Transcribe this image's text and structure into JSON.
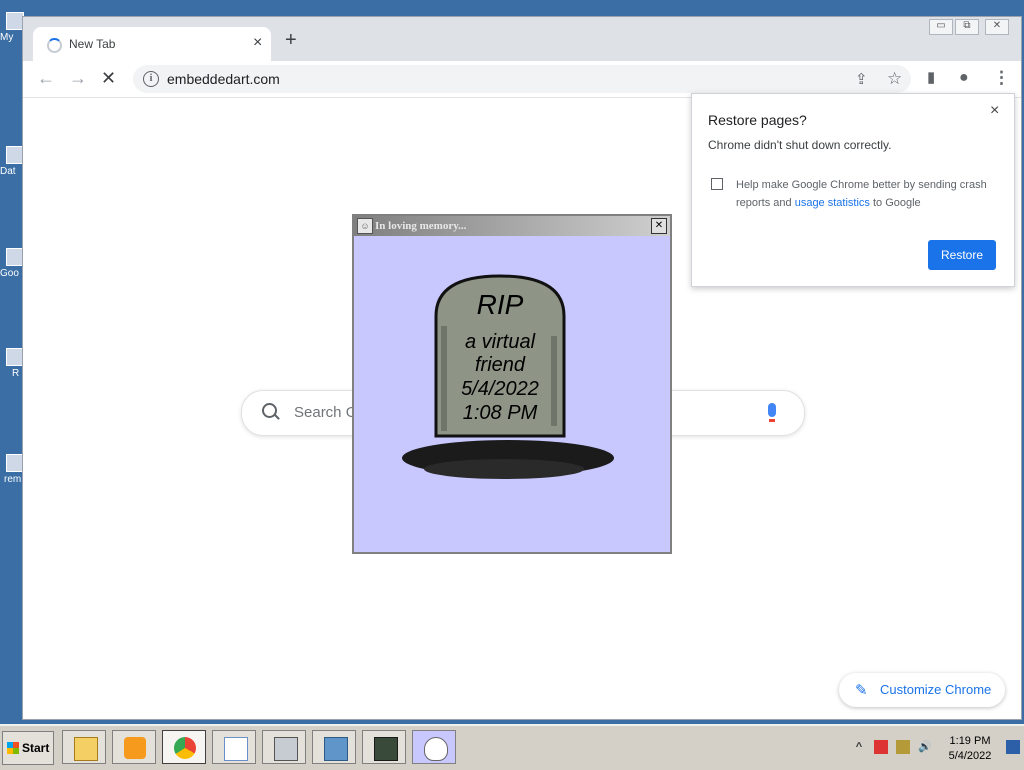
{
  "desktop": {
    "icons": [
      {
        "label": "My",
        "icon": "computer-icon"
      },
      {
        "label": "Dat",
        "icon": "data-icon"
      },
      {
        "label": "Goo",
        "icon": "google-icon"
      },
      {
        "label": "R",
        "icon": "shortcut-icon"
      },
      {
        "label": "rem",
        "icon": "remote-icon"
      }
    ]
  },
  "browser": {
    "tab": {
      "title": "New Tab",
      "close": "×"
    },
    "new_tab": "+",
    "window_controls": {
      "minimize": "▭",
      "restore": "⧉",
      "close": "✕"
    },
    "toolbar": {
      "back": "←",
      "forward": "→",
      "stop": "✕",
      "url": "embeddedart.com",
      "info_icon": "i",
      "share_icon": "⇪",
      "bookmark_icon": "☆",
      "sidepanel_icon": "▮",
      "profile_icon": "●",
      "menu_icon": "⋮"
    },
    "search": {
      "placeholder": "Search G"
    },
    "customize": {
      "label": "Customize Chrome",
      "icon": "✎"
    }
  },
  "restore_popup": {
    "title": "Restore pages?",
    "message": "Chrome didn't shut down correctly.",
    "help_text_prefix": "Help make Google Chrome better by sending crash reports and ",
    "help_link": "usage statistics",
    "help_text_suffix": " to Google",
    "checkbox_checked": false,
    "button_label": "Restore",
    "close": "×"
  },
  "memorial_window": {
    "title": "In loving memory...",
    "close": "✕",
    "tombstone": {
      "heading": "RIP",
      "line1": "a virtual",
      "line2": "friend",
      "date": "5/4/2022",
      "time": "1:08 PM"
    },
    "background_color": "#c8c8ff"
  },
  "taskbar": {
    "start_label": "Start",
    "buttons": [
      {
        "name": "explorer-taskbar-button",
        "icon": "folder-icon"
      },
      {
        "name": "media-player-taskbar-button",
        "icon": "media-player-icon"
      },
      {
        "name": "chrome-taskbar-button",
        "icon": "chrome-icon"
      },
      {
        "name": "notepad-taskbar-button",
        "icon": "document-icon"
      },
      {
        "name": "window-switcher-taskbar-button",
        "icon": "windows-stack-icon"
      },
      {
        "name": "control-panel-taskbar-button",
        "icon": "control-panel-icon"
      },
      {
        "name": "system-monitor-taskbar-button",
        "icon": "monitor-icon"
      },
      {
        "name": "bunny-taskbar-button",
        "icon": "bunny-icon"
      }
    ],
    "tray": {
      "expand": "^",
      "time": "1:19 PM",
      "date": "5/4/2022"
    }
  },
  "colors": {
    "desktop": "#3a6ea5",
    "chrome_accent": "#1a73e8",
    "memorial_bg": "#c8c8ff",
    "taskbar": "#d4d0c8"
  }
}
